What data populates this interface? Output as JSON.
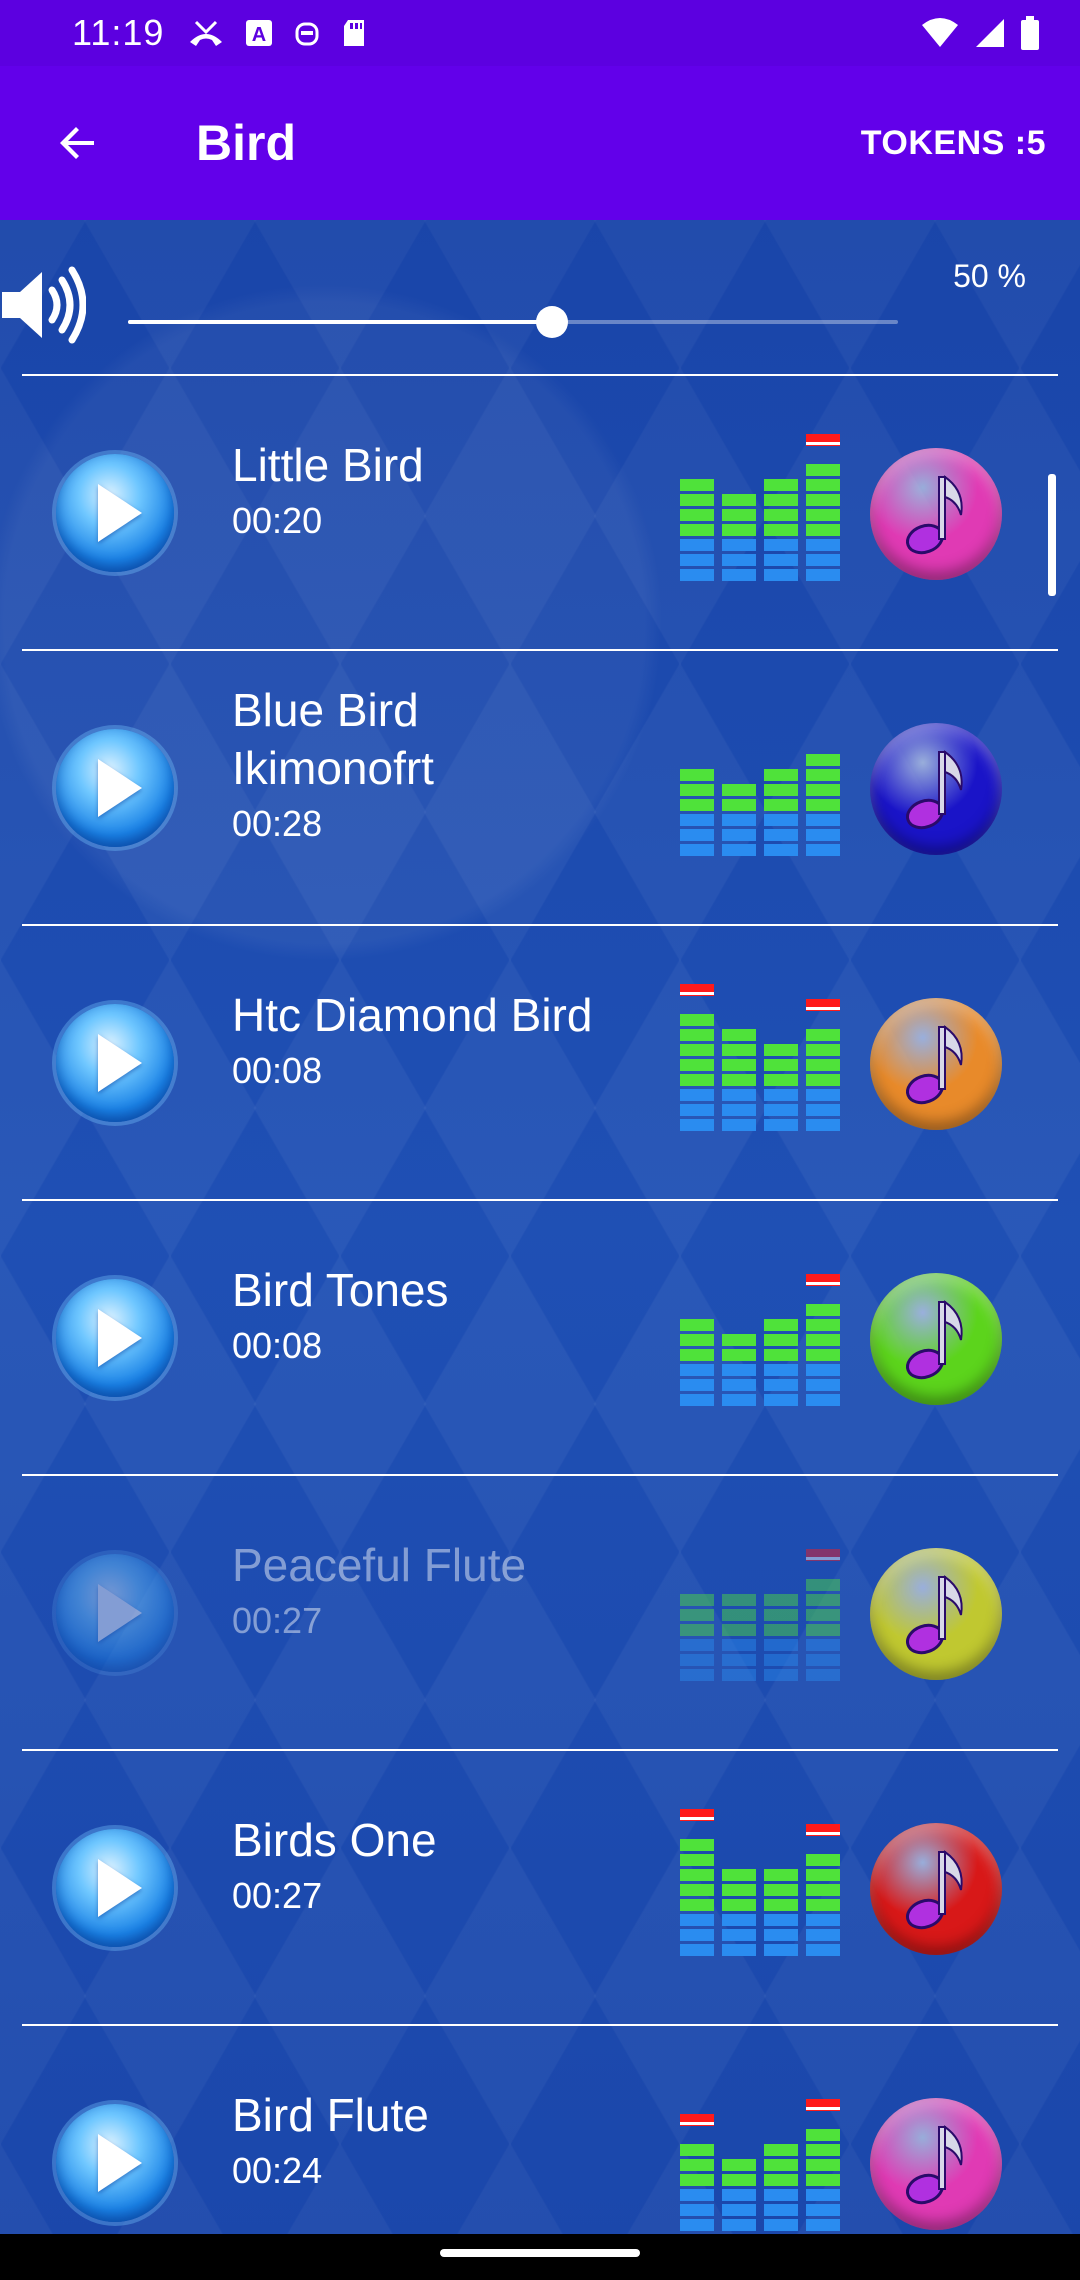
{
  "status_bar": {
    "time": "11:19",
    "icons": [
      "missed-call-icon",
      "auto-a-icon",
      "robot-icon",
      "sd-card-icon"
    ],
    "right_icons": [
      "wifi-icon",
      "signal-icon",
      "battery-icon"
    ]
  },
  "app_bar": {
    "title": "Bird",
    "tokens": "TOKENS :5"
  },
  "volume": {
    "level": 0.5,
    "percent_label": "50 %"
  },
  "tracks": [
    {
      "title": "Little Bird",
      "duration": "00:20",
      "note_color": "#e03ab4",
      "eq": [
        3,
        2,
        3,
        4
      ],
      "peak": [
        0,
        0,
        0,
        1
      ]
    },
    {
      "title": "Blue Bird\nIkimonofrt",
      "duration": "00:28",
      "note_color": "#1a14c8",
      "eq": [
        2,
        1,
        2,
        3
      ],
      "peak": [
        0,
        0,
        0,
        0
      ]
    },
    {
      "title": "Htc Diamond Bird",
      "duration": "00:08",
      "note_color": "#e88a2a",
      "eq": [
        4,
        3,
        2,
        3
      ],
      "peak": [
        1,
        0,
        0,
        1
      ]
    },
    {
      "title": "Bird Tones",
      "duration": "00:08",
      "note_color": "#5cd41c",
      "eq": [
        2,
        1,
        2,
        3
      ],
      "peak": [
        0,
        0,
        0,
        1
      ]
    },
    {
      "title": "Peaceful Flute",
      "duration": "00:27",
      "note_color": "#c0c830",
      "eq": [
        2,
        2,
        2,
        3
      ],
      "peak": [
        0,
        0,
        0,
        1
      ]
    },
    {
      "title": "Birds One",
      "duration": "00:27",
      "note_color": "#d81818",
      "eq": [
        4,
        2,
        2,
        3
      ],
      "peak": [
        1,
        0,
        0,
        1
      ]
    },
    {
      "title": "Bird Flute",
      "duration": "00:24",
      "note_color": "#e03ab4",
      "eq": [
        2,
        1,
        2,
        3
      ],
      "peak": [
        1,
        0,
        0,
        1
      ]
    }
  ],
  "dim_index": 4
}
